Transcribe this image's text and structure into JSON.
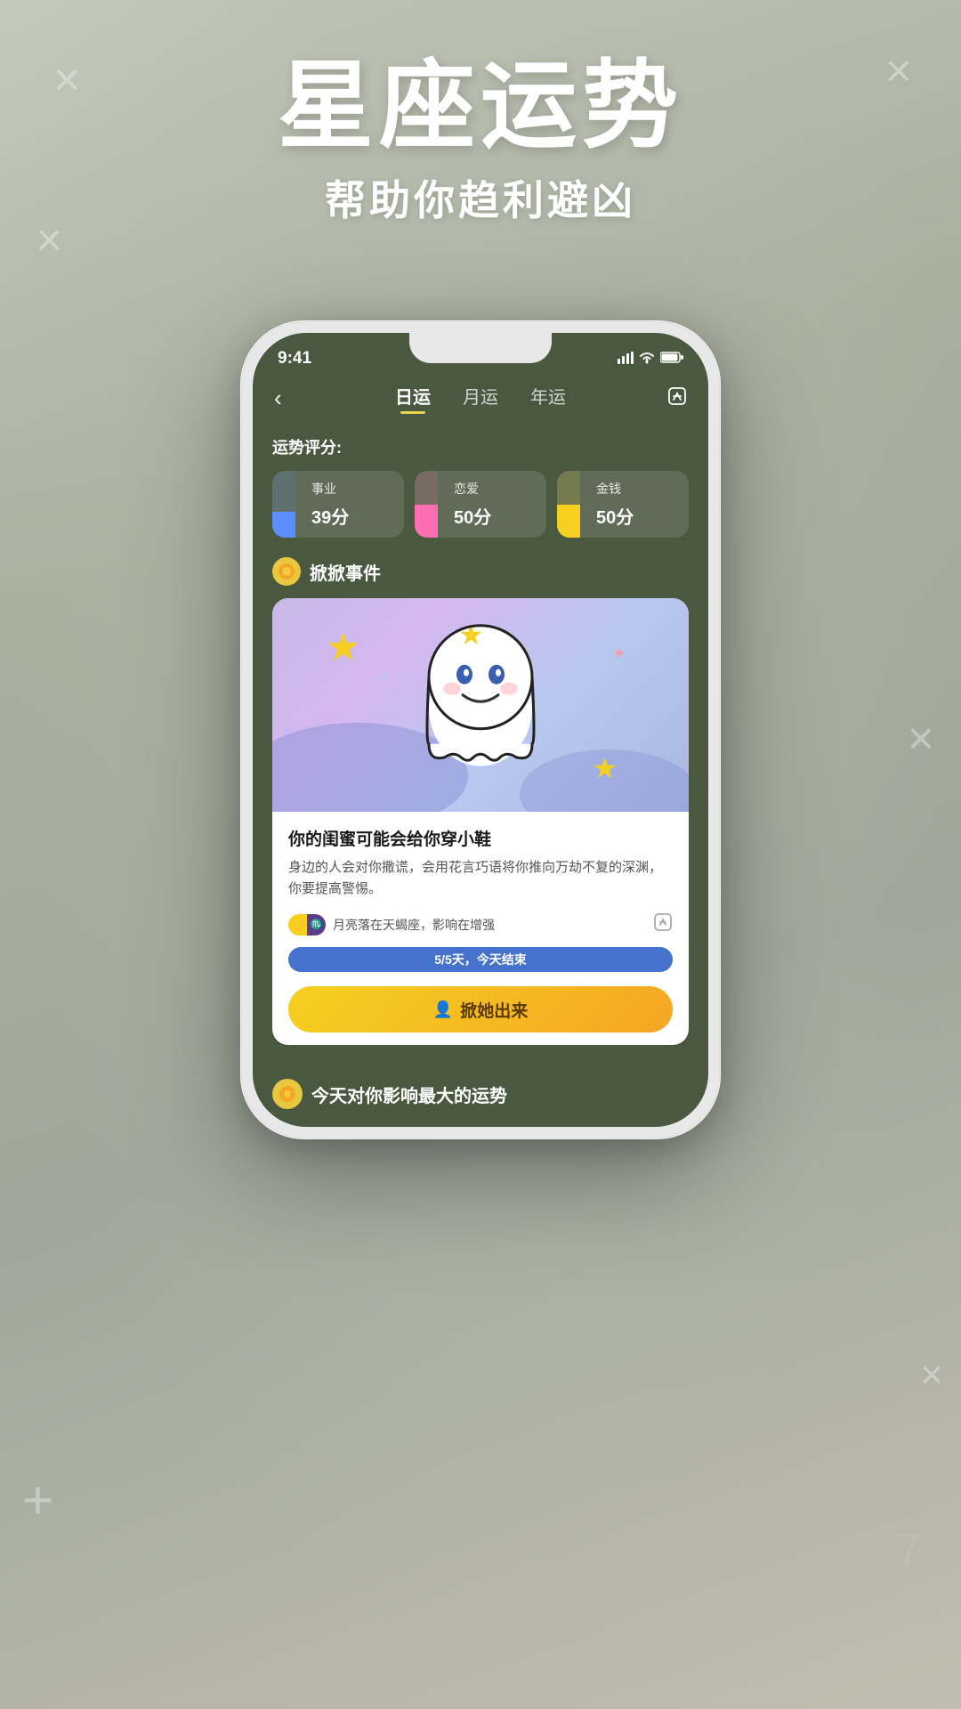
{
  "background": {
    "color_from": "#c5c9bc",
    "color_to": "#9ea89a"
  },
  "title": {
    "main": "星座运势",
    "sub": "帮助你趋利避凶"
  },
  "phone": {
    "status_bar": {
      "time": "9:41",
      "signal": "▋▋▋",
      "wifi": "wifi",
      "battery": "battery"
    },
    "nav": {
      "back_icon": "‹",
      "tabs": [
        {
          "label": "日运",
          "active": true
        },
        {
          "label": "月运",
          "active": false
        },
        {
          "label": "年运",
          "active": false
        }
      ],
      "share_icon": "⬆"
    },
    "scores": {
      "label": "运势评分:",
      "items": [
        {
          "name": "事业",
          "value": "39分",
          "color": "#5b8fff",
          "pct": 39
        },
        {
          "name": "恋爱",
          "value": "50分",
          "color": "#ff6eb0",
          "pct": 50
        },
        {
          "name": "金钱",
          "value": "50分",
          "color": "#f5d020",
          "pct": 50
        }
      ]
    },
    "section_tantan": {
      "icon": "😺",
      "title": "掀掀事件"
    },
    "event_card": {
      "title": "你的闺蜜可能会给你穿小鞋",
      "desc": "身边的人会对你撒谎，会用花言巧语将你推向万劫不复的深渊，你要提高警惕。",
      "moon_text": "月亮落在天蝎座，影响在增强",
      "progress_text": "5/5天，今天结束",
      "action_label": "掀她出来",
      "action_icon": "👤"
    },
    "bottom_section": {
      "icon": "😺",
      "title": "今天对你影响最大的运势"
    }
  },
  "deco_marks": [
    "×",
    "×",
    "×",
    "×",
    "×",
    "+",
    "+"
  ]
}
